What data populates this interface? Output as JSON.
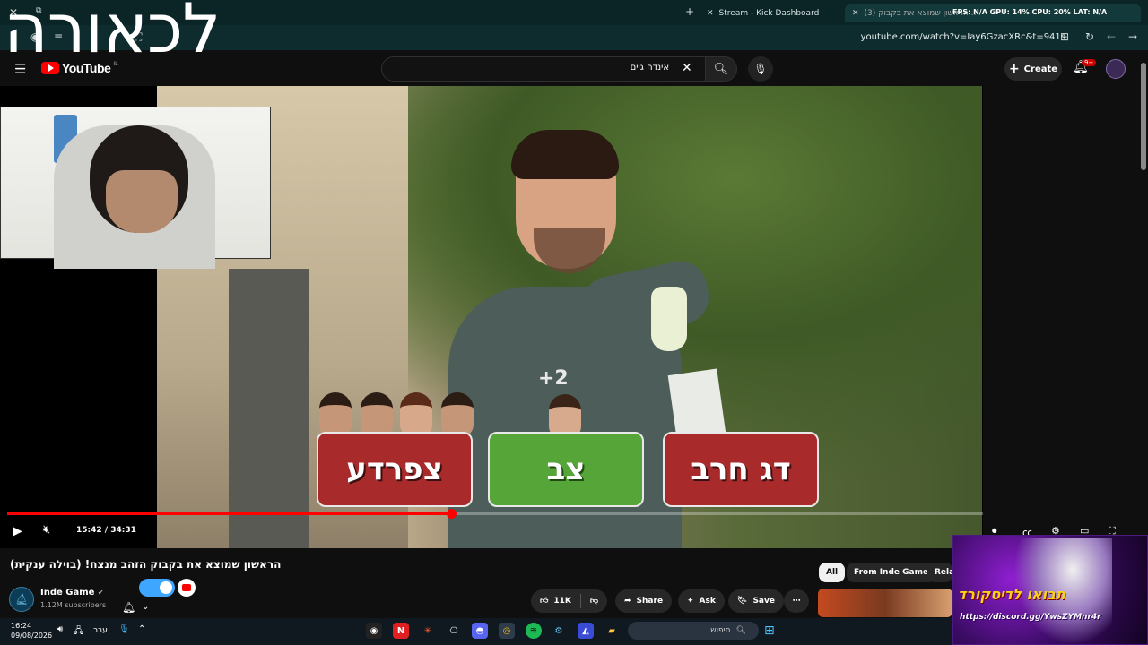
{
  "overlay": {
    "title": "לכאורה"
  },
  "browser": {
    "tabs": [
      {
        "label": "Stream - Kick Dashboard"
      },
      {
        "label": "(3) הראשון שמוצא את בקבוק..."
      }
    ],
    "stats": "FPS: N/A  GPU: 14%  CPU: 20%  LAT: N/A",
    "url": "youtube.com/watch?v=Iay6GzacXRc&t=941s"
  },
  "youtube": {
    "logo_text": "YouTube",
    "logo_region": "IL",
    "search": {
      "value": "אינדה גיים"
    },
    "create_label": "Create",
    "notifications_badge": "9+"
  },
  "video": {
    "choices": [
      {
        "label": "צפרדע"
      },
      {
        "label": "צב"
      },
      {
        "label": "דג חרב"
      }
    ],
    "plus_count": "+2",
    "time": "15:42 / 34:31",
    "progress_fraction": 0.455
  },
  "info": {
    "title": "הראשון שמוצא את בקבוק הזהב מנצח! (בוילה ענקית)",
    "channel_name": "Inde Game",
    "subscribers": "1.12M subscribers",
    "likes": "11K",
    "share_label": "Share",
    "ask_label": "Ask",
    "save_label": "Save",
    "chips": [
      {
        "label": "All"
      },
      {
        "label": "From Inde Game"
      },
      {
        "label": "Rela"
      }
    ]
  },
  "promo": {
    "title": "תבואו לדיסקורד",
    "link": "https://discord.gg/YwsZYMnr4r"
  },
  "taskbar": {
    "time": "16:24",
    "date": "09/08/2026",
    "lang": "עבר",
    "search_placeholder": "חיפוש"
  }
}
